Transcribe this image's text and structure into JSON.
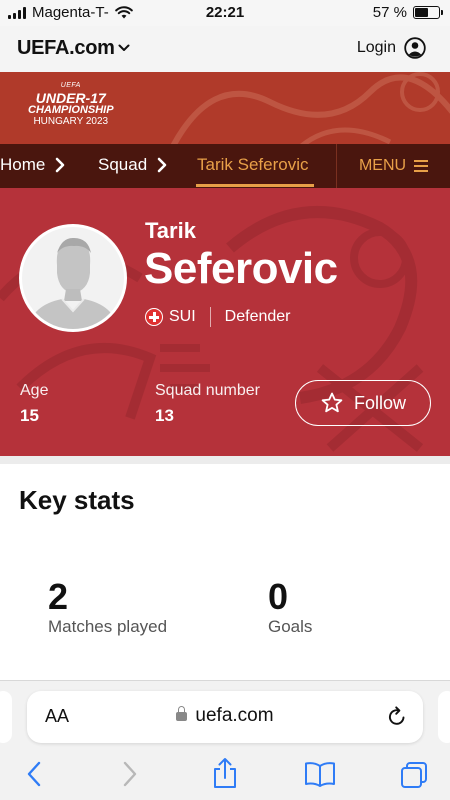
{
  "status_bar": {
    "carrier": "Magenta-T-",
    "time": "22:21",
    "battery": "57 %",
    "battery_level": 0.57
  },
  "site_header": {
    "logo": "UEFA.com",
    "login_label": "Login"
  },
  "tournament": {
    "logo_top": "UEFA",
    "logo_main": "UNDER-17",
    "logo_sub": "CHAMPIONSHIP",
    "logo_year": "HUNGARY 2023"
  },
  "breadcrumb": {
    "items": [
      {
        "label": "Home"
      },
      {
        "label": "Squad"
      },
      {
        "label": "Tarik Seferovic"
      }
    ],
    "menu_label": "MENU"
  },
  "player": {
    "first_name": "Tarik",
    "last_name": "Seferovic",
    "country": "SUI",
    "position": "Defender",
    "age_label": "Age",
    "age": "15",
    "squad_number_label": "Squad number",
    "squad_number": "13",
    "follow_label": "Follow"
  },
  "key_stats": {
    "title": "Key stats",
    "stats": [
      {
        "value": "2",
        "label": "Matches played"
      },
      {
        "value": "0",
        "label": "Goals"
      }
    ]
  },
  "browser": {
    "aa_label": "AA",
    "url": "uefa.com"
  },
  "colors": {
    "hero_bg": "#b5323a",
    "banner_bg": "#b03a2a",
    "breadcrumb_bg": "#4a160e",
    "accent": "#e8a048"
  }
}
